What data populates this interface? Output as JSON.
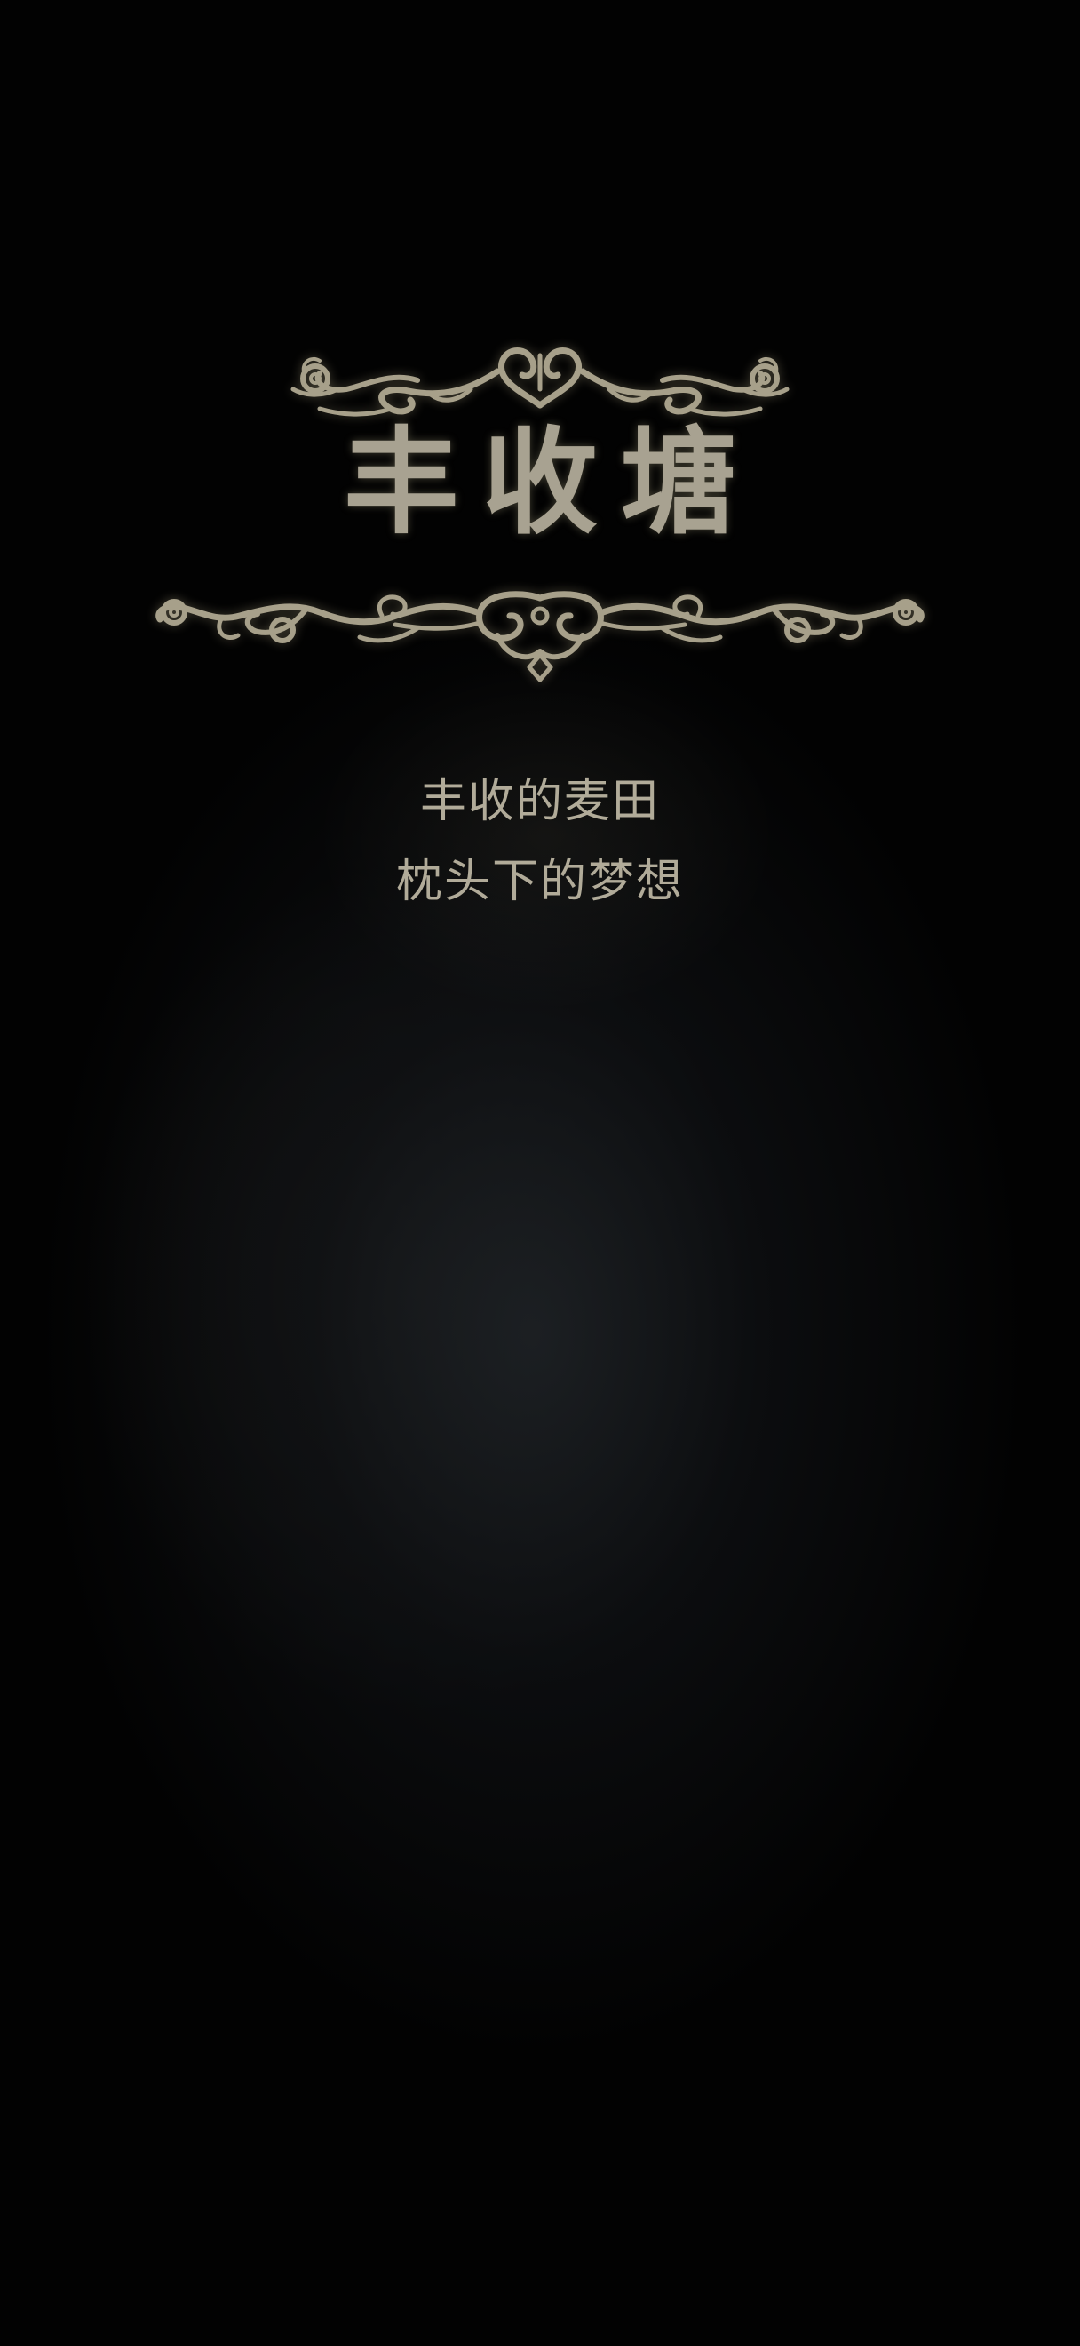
{
  "screen": {
    "title": "丰收塘",
    "subtitle_lines": [
      "丰收的麦田",
      "枕头下的梦想"
    ]
  },
  "decor": {
    "top_flourish_icon": "ornamental-scroll-icon",
    "bottom_flourish_icon": "ornamental-scroll-icon"
  },
  "colors": {
    "background": "#020202",
    "ornament": "#a7a08a",
    "title_text": "#a8a291",
    "subtitle_text": "#b1ab99"
  }
}
